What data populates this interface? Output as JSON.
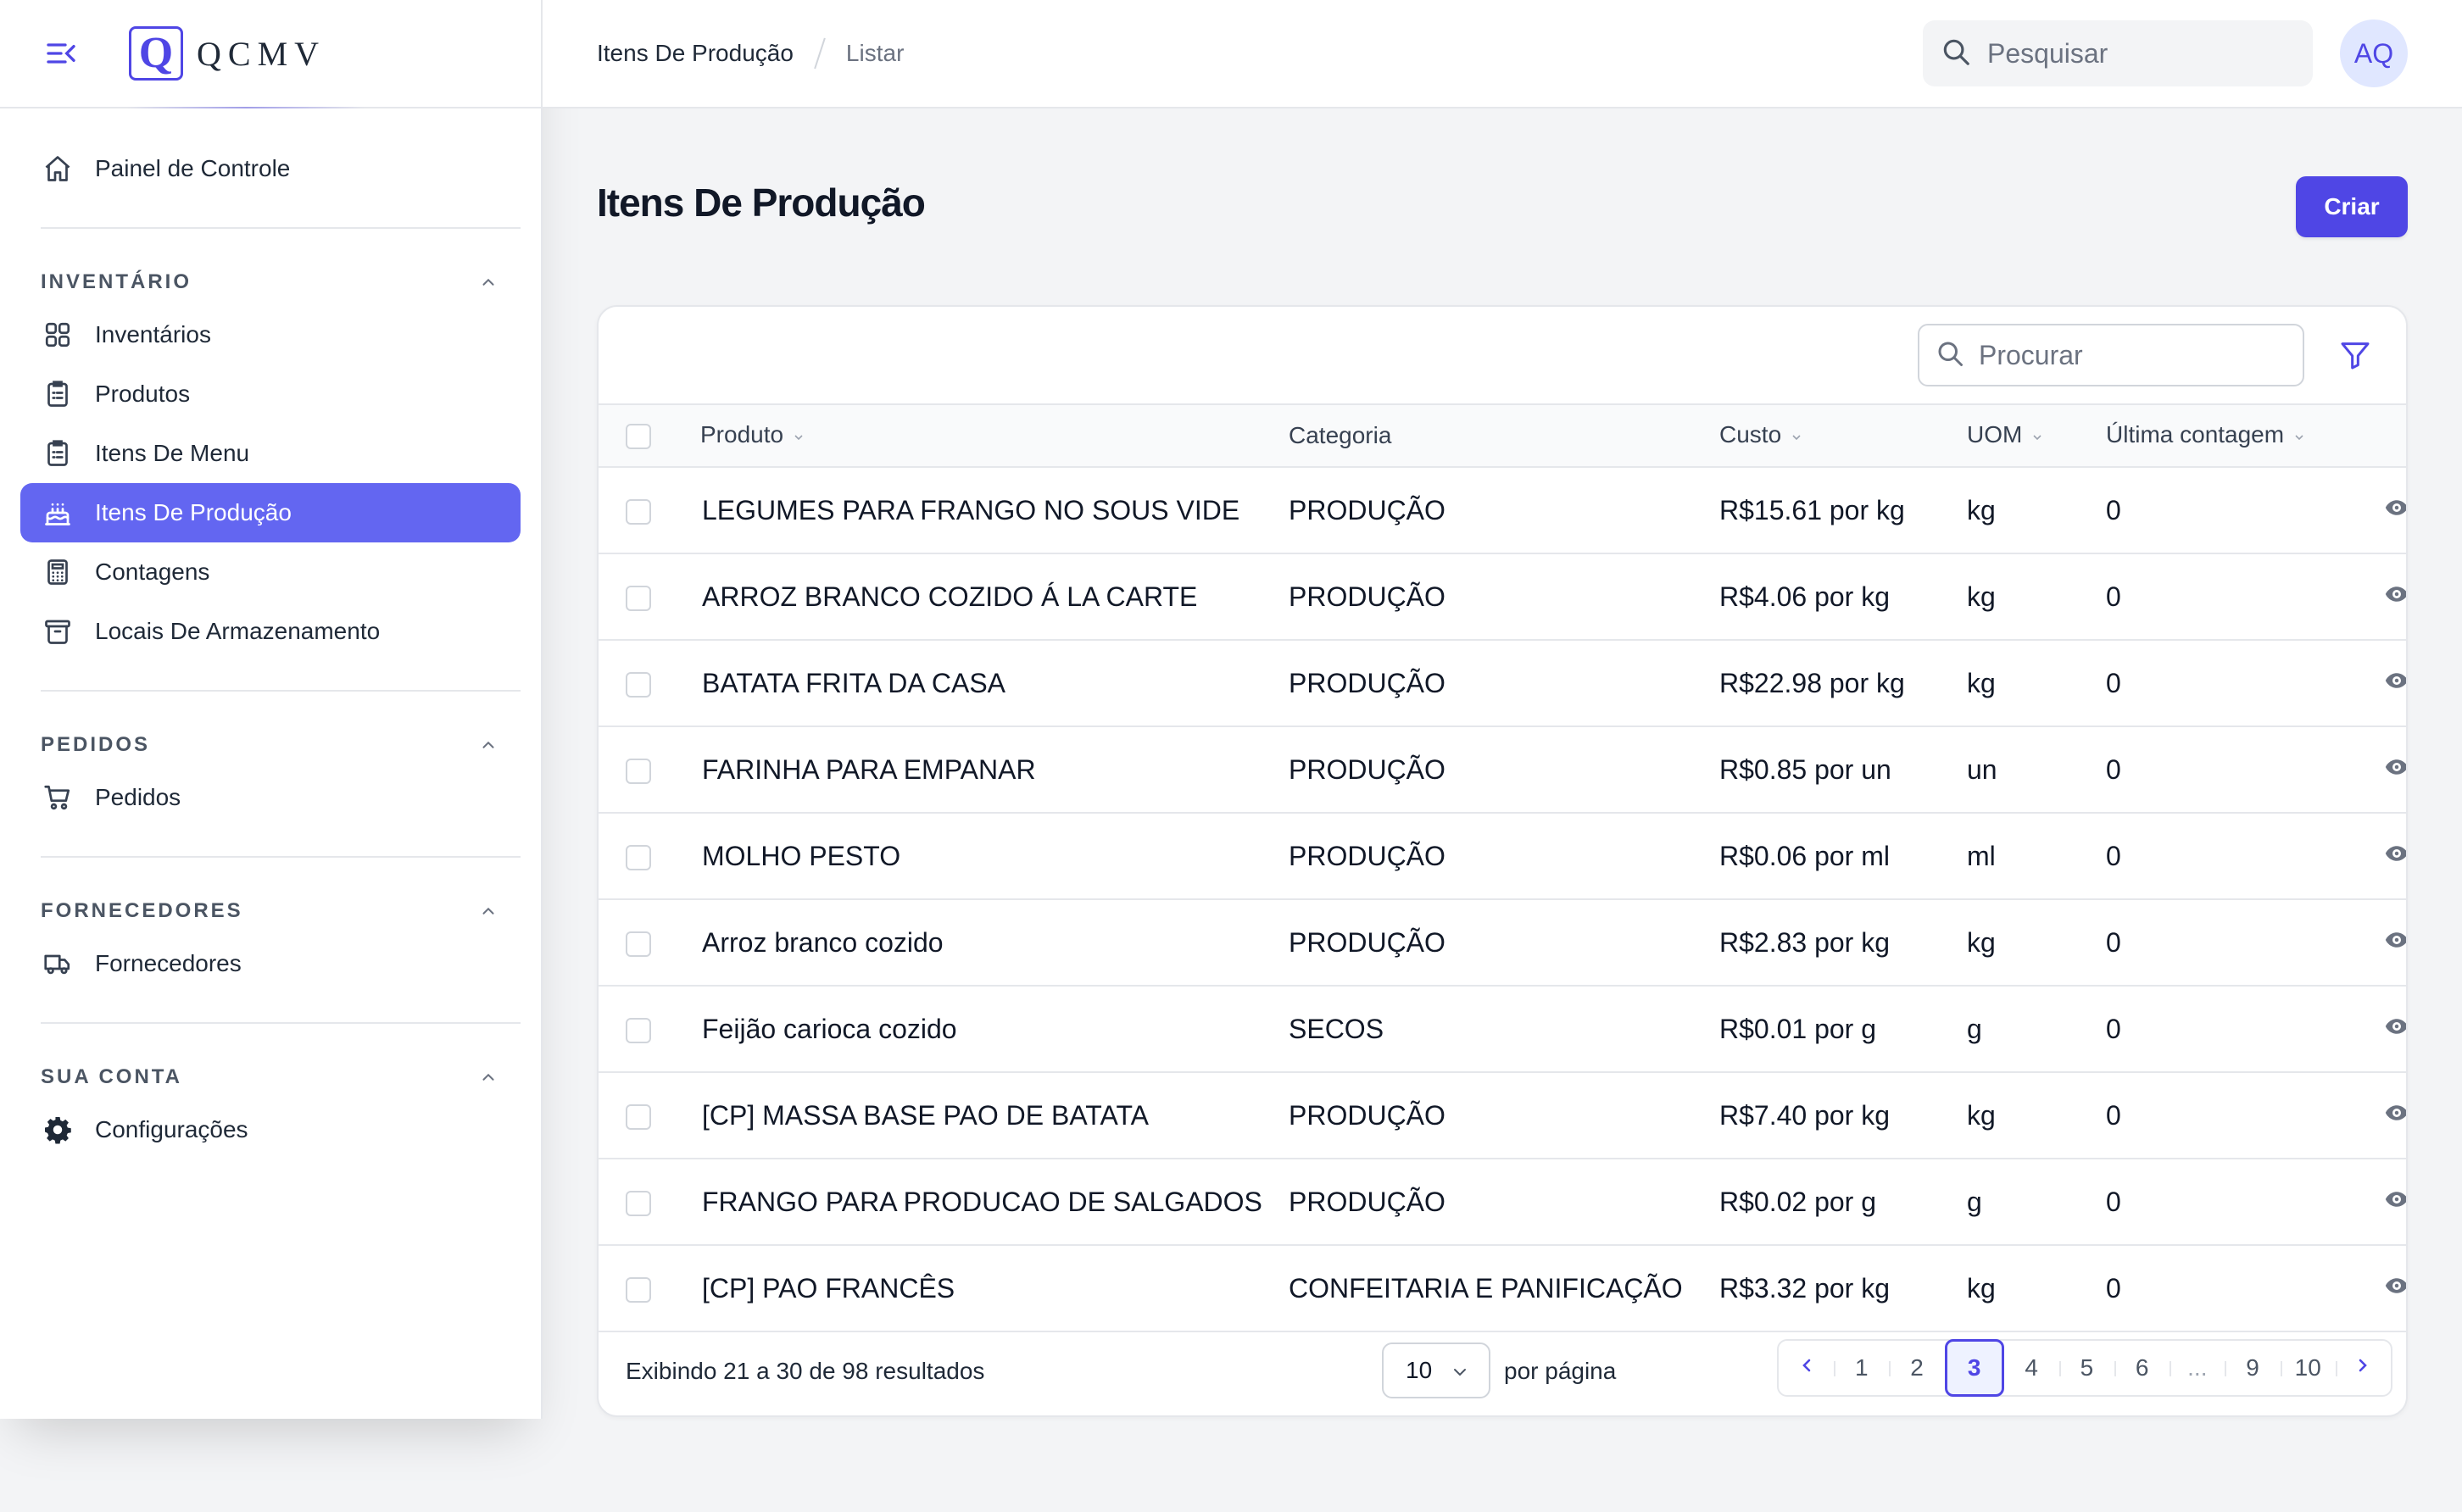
{
  "brand": {
    "logo_letter": "Q",
    "name": "QCMV"
  },
  "sidebar": {
    "dashboard": "Painel de Controle",
    "groups": [
      {
        "title": "INVENTÁRIO",
        "items": [
          "Inventários",
          "Produtos",
          "Itens De Menu",
          "Itens De Produção",
          "Contagens",
          "Locais De Armazenamento"
        ]
      },
      {
        "title": "PEDIDOS",
        "items": [
          "Pedidos"
        ]
      },
      {
        "title": "FORNECEDORES",
        "items": [
          "Fornecedores"
        ]
      },
      {
        "title": "SUA CONTA",
        "items": [
          "Configurações"
        ]
      }
    ],
    "active_item": "Itens De Produção"
  },
  "topbar": {
    "breadcrumb": [
      "Itens De Produção",
      "Listar"
    ],
    "search_placeholder": "Pesquisar",
    "avatar_initials": "AQ"
  },
  "page": {
    "title": "Itens De Produção",
    "create_label": "Criar"
  },
  "table": {
    "search_placeholder": "Procurar",
    "columns": [
      "Produto",
      "Categoria",
      "Custo",
      "UOM",
      "Última contagem"
    ],
    "rows": [
      {
        "produto": "LEGUMES PARA FRANGO NO SOUS VIDE",
        "categoria": "PRODUÇÃO",
        "custo": "R$15.61 por kg",
        "uom": "kg",
        "ultima": "0"
      },
      {
        "produto": "ARROZ BRANCO COZIDO Á LA CARTE",
        "categoria": "PRODUÇÃO",
        "custo": "R$4.06 por kg",
        "uom": "kg",
        "ultima": "0"
      },
      {
        "produto": "BATATA FRITA DA CASA",
        "categoria": "PRODUÇÃO",
        "custo": "R$22.98 por kg",
        "uom": "kg",
        "ultima": "0"
      },
      {
        "produto": "FARINHA PARA EMPANAR",
        "categoria": "PRODUÇÃO",
        "custo": "R$0.85 por un",
        "uom": "un",
        "ultima": "0"
      },
      {
        "produto": "MOLHO PESTO",
        "categoria": "PRODUÇÃO",
        "custo": "R$0.06 por ml",
        "uom": "ml",
        "ultima": "0"
      },
      {
        "produto": "Arroz branco cozido",
        "categoria": "PRODUÇÃO",
        "custo": "R$2.83 por kg",
        "uom": "kg",
        "ultima": "0"
      },
      {
        "produto": "Feijão carioca cozido",
        "categoria": "SECOS",
        "custo": "R$0.01 por g",
        "uom": "g",
        "ultima": "0"
      },
      {
        "produto": "[CP] MASSA BASE PAO DE BATATA",
        "categoria": "PRODUÇÃO",
        "custo": "R$7.40 por kg",
        "uom": "kg",
        "ultima": "0"
      },
      {
        "produto": "FRANGO PARA PRODUCAO DE SALGADOS",
        "categoria": "PRODUÇÃO",
        "custo": "R$0.02 por g",
        "uom": "g",
        "ultima": "0"
      },
      {
        "produto": "[CP] PAO FRANCÊS",
        "categoria": "CONFEITARIA E PANIFICAÇÃO",
        "custo": "R$3.32 por kg",
        "uom": "kg",
        "ultima": "0"
      }
    ]
  },
  "footer": {
    "results_text": "Exibindo 21 a 30 de 98 resultados",
    "per_page_value": "10",
    "per_page_label": "por página",
    "pages": [
      "1",
      "2",
      "3",
      "4",
      "5",
      "6",
      "...",
      "9",
      "10"
    ],
    "current_page": "3"
  },
  "colors": {
    "accent": "#4f46e5",
    "active_bg": "#6366f1"
  }
}
